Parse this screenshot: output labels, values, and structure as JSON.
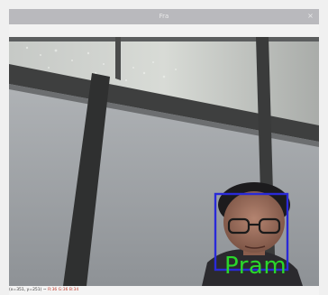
{
  "window": {
    "title": "Fra",
    "close_glyph": "×"
  },
  "detection": {
    "label": "Pram",
    "box_color": "#2a2ad8",
    "label_color": "#2ad72a"
  },
  "statusbar": {
    "coords": "(x=351, y=251) ~",
    "rgb": "R:36 G:36 B:34"
  }
}
